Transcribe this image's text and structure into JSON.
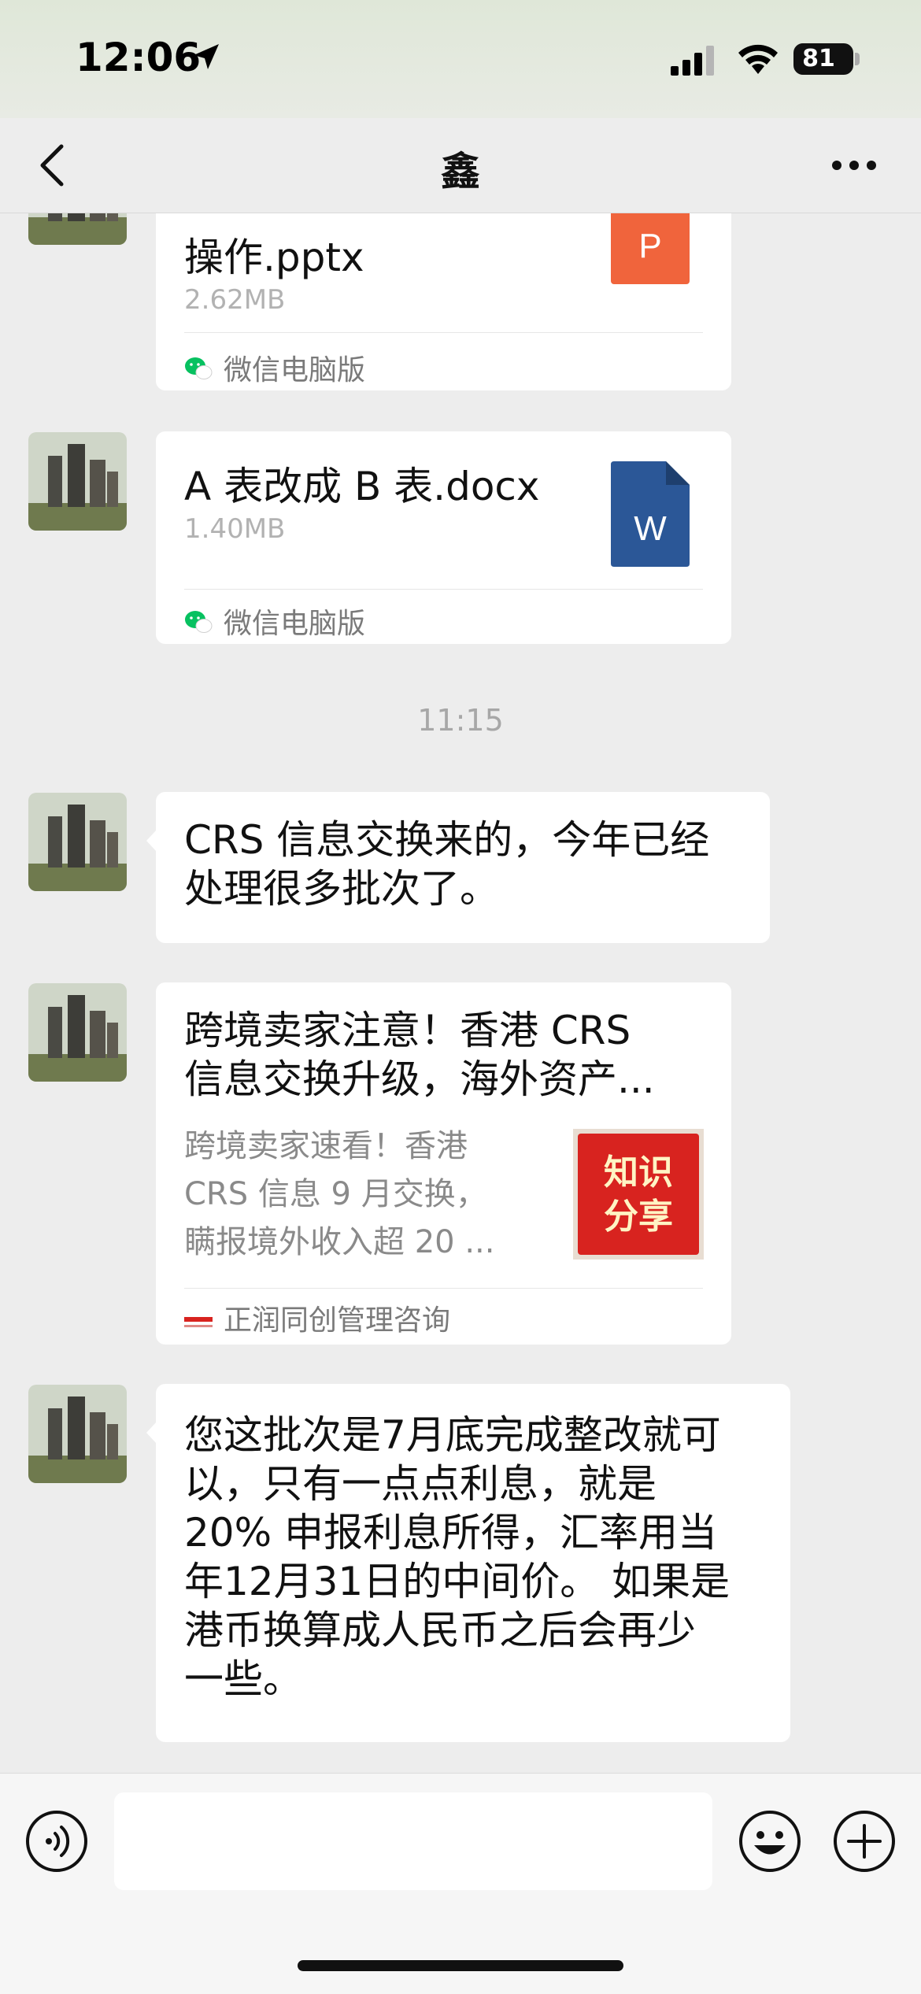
{
  "status": {
    "time": "12:06",
    "battery": "81"
  },
  "nav": {
    "title": "鑫"
  },
  "messages": {
    "file1": {
      "name": "操作.pptx",
      "size": "2.62MB",
      "source": "微信电脑版",
      "icon_letter": "P",
      "icon_color": "#f0643c"
    },
    "file2": {
      "name": "A 表改成 B 表.docx",
      "size": "1.40MB",
      "source": "微信电脑版",
      "icon_letter": "W",
      "icon_color": "#2b5797"
    },
    "timestamp": "11:15",
    "text1_line1": "CRS 信息交换来的，今年已经",
    "text1_line2": "处理很多批次了。",
    "article": {
      "title_line1": "跨境卖家注意！香港 CRS",
      "title_line2": "信息交换升级，海外资产...",
      "desc_line1": "跨境卖家速看！香港",
      "desc_line2": "CRS 信息 9 月交换，",
      "desc_line3": "瞒报境外收入超 20 ...",
      "thumb_line1": "知识",
      "thumb_line2": "分享",
      "source": "正润同创管理咨询"
    },
    "text2_lines": [
      "您这批次是7月底完成整改就可",
      "以，只有一点点利息，就是",
      "20% 申报利息所得，汇率用当",
      "年12月31日的中间价。 如果是",
      "港币换算成人民币之后会再少",
      "一些。"
    ]
  },
  "colors": {
    "background": "#ededed",
    "bubble": "#ffffff",
    "wechat_green": "#07c160"
  }
}
